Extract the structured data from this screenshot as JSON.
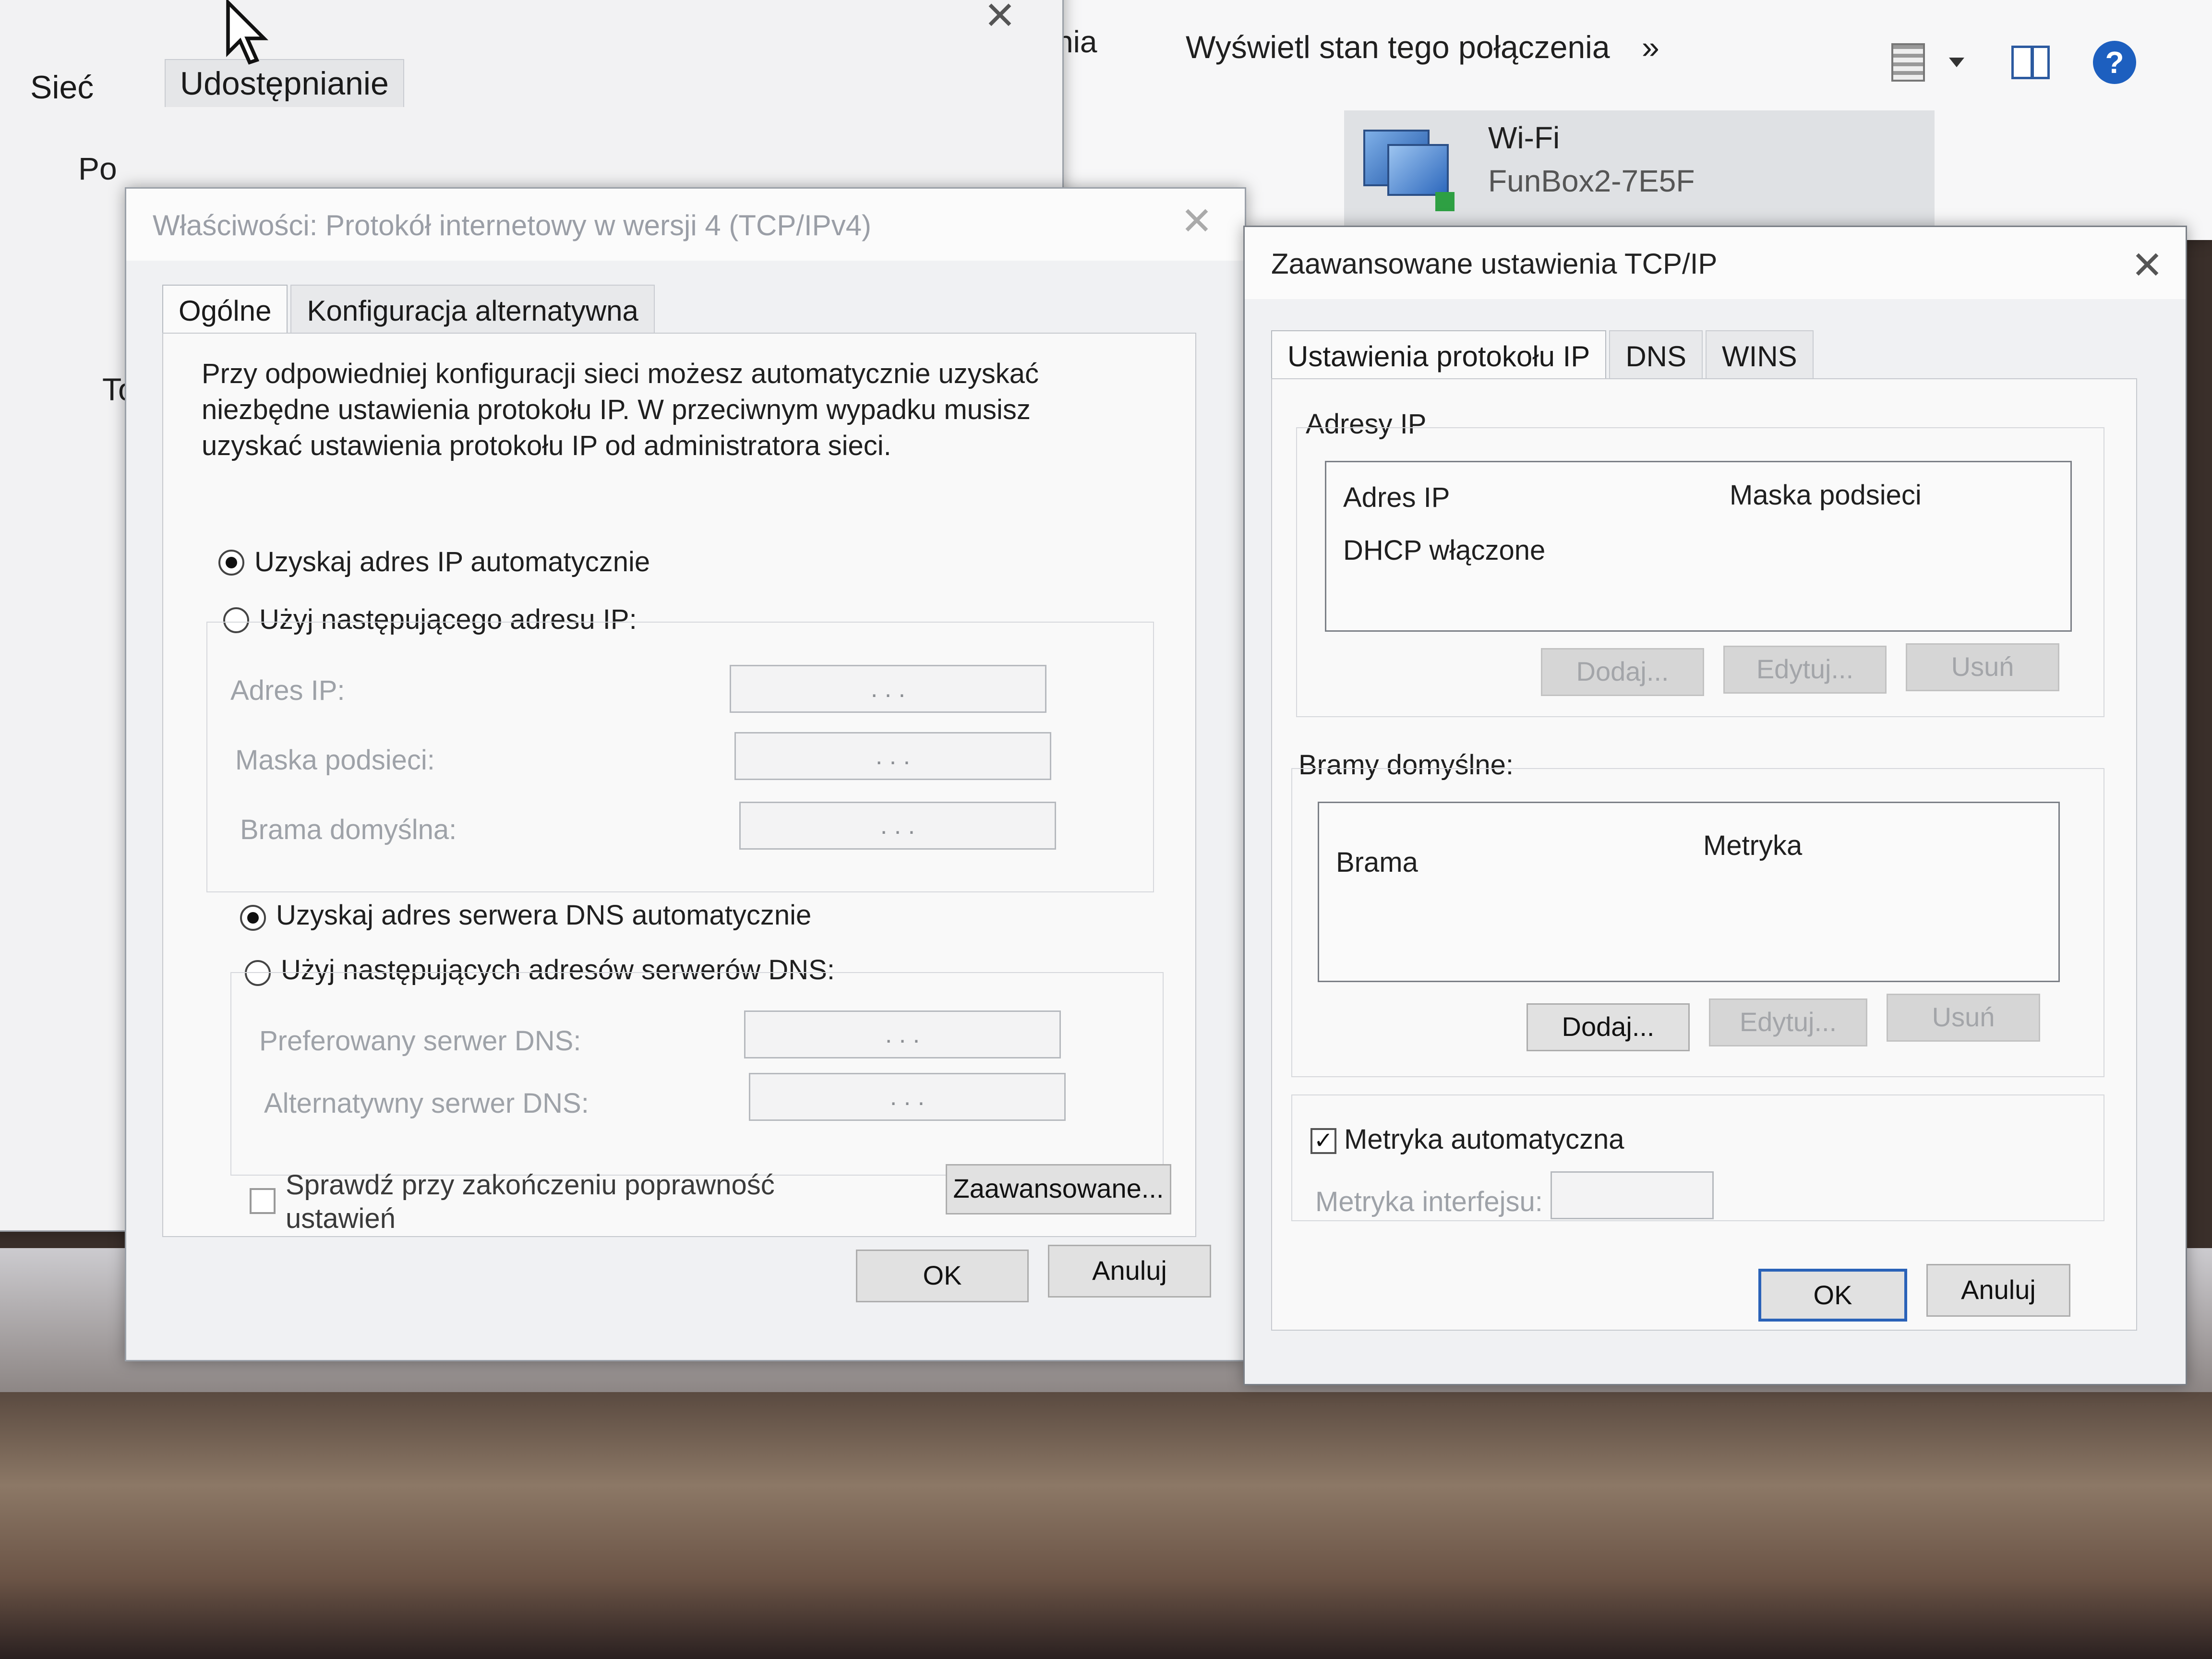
{
  "background_window_sieci": {
    "tabs": [
      "Sieć",
      "Udostępnianie"
    ],
    "partial_label_1": "Po",
    "partial_label_2": "To"
  },
  "explorer_toolbar": {
    "partial_left": "nia",
    "view_status": "Wyświetl stan tego połączenia",
    "more": "»",
    "help_icon": "?"
  },
  "connection": {
    "name": "Wi-Fi",
    "network": "FunBox2-7E5F"
  },
  "ipv4_dialog": {
    "title": "Właściwości: Protokół internetowy w wersji 4 (TCP/IPv4)",
    "close": "✕",
    "tabs": [
      "Ogólne",
      "Konfiguracja alternatywna"
    ],
    "description_lines": [
      "Przy odpowiedniej konfiguracji sieci możesz automatycznie uzyskać",
      "niezbędne ustawienia protokołu IP. W przeciwnym wypadku musisz",
      "uzyskać ustawienia protokołu IP od administratora sieci."
    ],
    "ip_auto": "Uzyskaj adres IP automatycznie",
    "ip_manual": "Użyj następującego adresu IP:",
    "ip_address_label": "Adres IP:",
    "subnet_label": "Maska podsieci:",
    "gateway_label": "Brama domyślna:",
    "ip_dots": ".   .   .",
    "dns_auto": "Uzyskaj adres serwera DNS automatycznie",
    "dns_manual": "Użyj następujących adresów serwerów DNS:",
    "dns_pref_label": "Preferowany serwer DNS:",
    "dns_alt_label": "Alternatywny serwer DNS:",
    "validate_line1": "Sprawdź przy zakończeniu poprawność",
    "validate_line2": "ustawień",
    "advanced_button": "Zaawansowane...",
    "ok": "OK",
    "cancel": "Anuluj"
  },
  "advanced_dialog": {
    "title": "Zaawansowane ustawienia TCP/IP",
    "close": "✕",
    "tabs": [
      "Ustawienia protokołu IP",
      "DNS",
      "WINS"
    ],
    "ip_section": "Adresy IP",
    "ip_col1": "Adres IP",
    "ip_col2": "Maska podsieci",
    "ip_row": "DHCP włączone",
    "add1": "Dodaj...",
    "edit1": "Edytuj...",
    "remove1": "Usuń",
    "gw_section": "Bramy domyślne:",
    "gw_col1": "Brama",
    "gw_col2": "Metryka",
    "add2": "Dodaj...",
    "edit2": "Edytuj...",
    "remove2": "Usuń",
    "auto_metric": "Metryka automatyczna",
    "auto_metric_checked": true,
    "interface_metric": "Metryka interfejsu:",
    "ok": "OK",
    "cancel": "Anuluj"
  }
}
